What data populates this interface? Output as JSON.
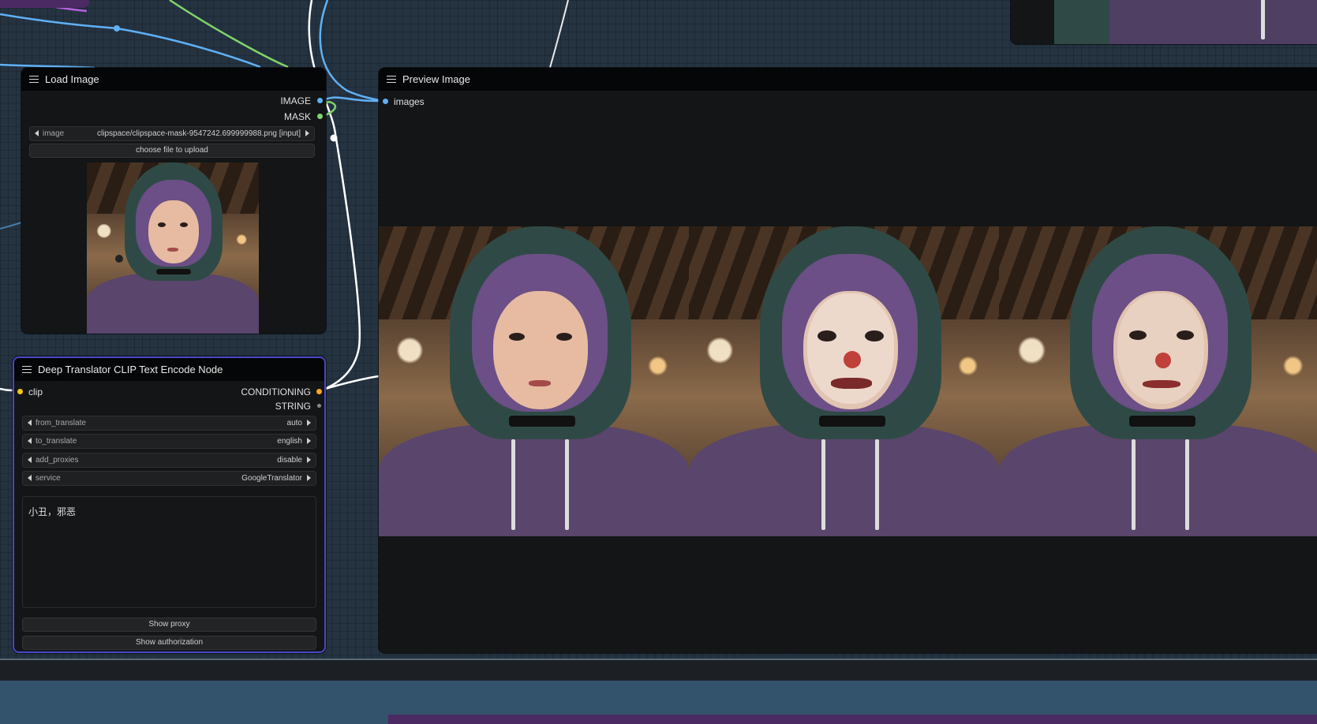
{
  "load_image": {
    "title": "Load Image",
    "outputs": [
      "IMAGE",
      "MASK"
    ],
    "image_widget": {
      "label": "image",
      "value": "clipspace/clipspace-mask-9547242.699999988.png [input]"
    },
    "upload_button": "choose file to upload"
  },
  "translator": {
    "title": "Deep Translator CLIP Text Encode Node",
    "input": "clip",
    "outputs": [
      "CONDITIONING",
      "STRING"
    ],
    "widgets": [
      {
        "label": "from_translate",
        "value": "auto"
      },
      {
        "label": "to_translate",
        "value": "english"
      },
      {
        "label": "add_proxies",
        "value": "disable"
      },
      {
        "label": "service",
        "value": "GoogleTranslator"
      }
    ],
    "prompt_text": "小丑，邪恶",
    "buttons": [
      "Show proxy",
      "Show authorization"
    ]
  },
  "preview": {
    "title": "Preview Image",
    "input": "images"
  },
  "colors": {
    "image_slot": "#5fb1f5",
    "mask_slot": "#7fd46a",
    "clip_slot": "#f5c518",
    "conditioning_slot": "#f5a623",
    "string_slot": "#8a8a8a",
    "selected_border": "#4a47c9"
  }
}
